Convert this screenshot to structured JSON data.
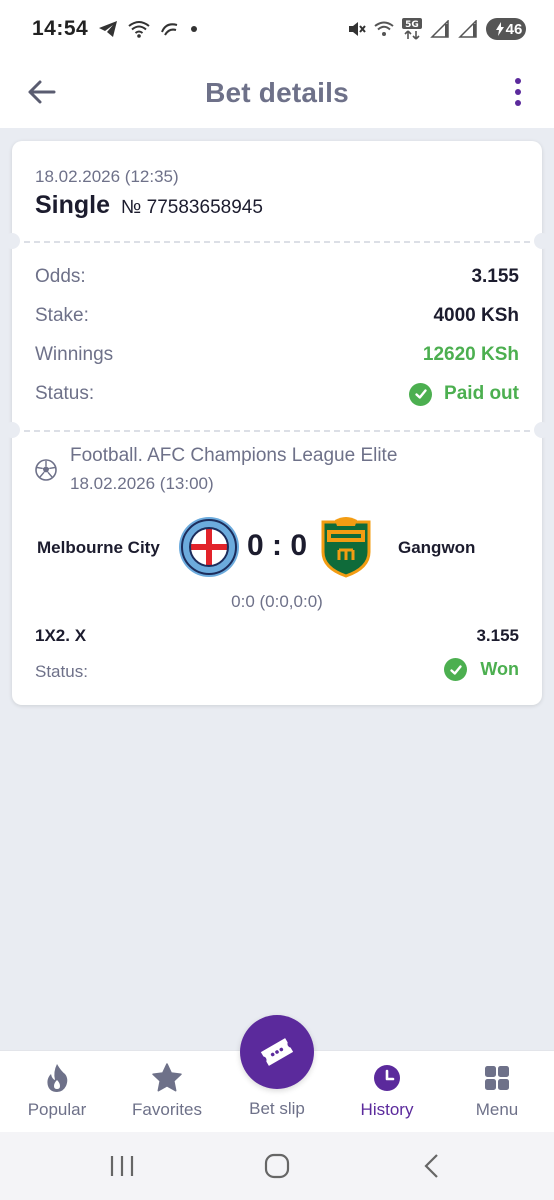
{
  "status_bar": {
    "time": "14:54",
    "battery": "46",
    "network": "5G"
  },
  "header": {
    "title": "Bet details"
  },
  "bet": {
    "date": "18.02.2026 (12:35)",
    "type": "Single",
    "number": "№ 77583658945",
    "odds_label": "Odds:",
    "odds_value": "3.155",
    "stake_label": "Stake:",
    "stake_value": "4000 KSh",
    "winnings_label": "Winnings",
    "winnings_value": "12620 KSh",
    "status_label": "Status:",
    "status_value": "Paid out"
  },
  "event": {
    "league": "Football. AFC Champions League Elite",
    "date": "18.02.2026 (13:00)",
    "home_team": "Melbourne City",
    "away_team": "Gangwon",
    "score": "0 : 0",
    "score_detail": "0:0 (0:0,0:0)",
    "market": "1X2. X",
    "market_odds": "3.155",
    "status_label": "Status:",
    "status_value": "Won"
  },
  "bottom_nav": {
    "items": [
      {
        "label": "Popular",
        "icon": "flame-icon"
      },
      {
        "label": "Favorites",
        "icon": "star-icon"
      },
      {
        "label": "Bet slip",
        "icon": "ticket-icon"
      },
      {
        "label": "History",
        "icon": "clock-icon"
      },
      {
        "label": "Menu",
        "icon": "grid-icon"
      }
    ],
    "active": "History"
  },
  "colors": {
    "accent": "#5b2a9c",
    "success": "#4caf50",
    "muted_text": "#6e7189",
    "background": "#e9ecf2"
  }
}
